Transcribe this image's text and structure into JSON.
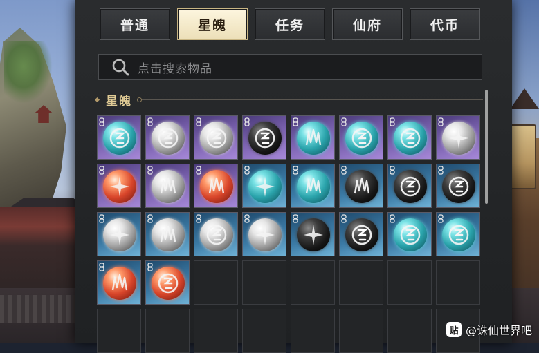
{
  "tabs": [
    {
      "label": "普通",
      "active": false
    },
    {
      "label": "星魄",
      "active": true
    },
    {
      "label": "任务",
      "active": false
    },
    {
      "label": "仙府",
      "active": false
    },
    {
      "label": "代币",
      "active": false
    }
  ],
  "search": {
    "placeholder": "点击搜索物品",
    "icon": "search-icon"
  },
  "section": {
    "title": "星魄"
  },
  "items": [
    {
      "bg": "purple",
      "orb": "cyan",
      "symbol": "spiral"
    },
    {
      "bg": "purple",
      "orb": "white",
      "symbol": "spiral"
    },
    {
      "bg": "purple",
      "orb": "white",
      "symbol": "spiral"
    },
    {
      "bg": "purple",
      "orb": "black",
      "symbol": "spiral"
    },
    {
      "bg": "purple",
      "orb": "cyan",
      "symbol": "spikes"
    },
    {
      "bg": "purple",
      "orb": "cyan",
      "symbol": "spiral"
    },
    {
      "bg": "purple",
      "orb": "cyan",
      "symbol": "spiral"
    },
    {
      "bg": "purple",
      "orb": "white",
      "symbol": "star"
    },
    {
      "bg": "purple",
      "orb": "red",
      "symbol": "star"
    },
    {
      "bg": "purple",
      "orb": "white",
      "symbol": "spikes"
    },
    {
      "bg": "purple",
      "orb": "red",
      "symbol": "spikes"
    },
    {
      "bg": "blue",
      "orb": "cyan",
      "symbol": "star"
    },
    {
      "bg": "blue",
      "orb": "cyan",
      "symbol": "spikes"
    },
    {
      "bg": "blue",
      "orb": "black",
      "symbol": "spikes"
    },
    {
      "bg": "blue",
      "orb": "black",
      "symbol": "spiral"
    },
    {
      "bg": "blue",
      "orb": "black",
      "symbol": "spiral"
    },
    {
      "bg": "blue",
      "orb": "white",
      "symbol": "star"
    },
    {
      "bg": "blue",
      "orb": "white",
      "symbol": "spikes"
    },
    {
      "bg": "blue",
      "orb": "white",
      "symbol": "spiral"
    },
    {
      "bg": "blue",
      "orb": "white",
      "symbol": "star"
    },
    {
      "bg": "blue",
      "orb": "black",
      "symbol": "star"
    },
    {
      "bg": "blue",
      "orb": "black",
      "symbol": "spiral"
    },
    {
      "bg": "blue",
      "orb": "cyan",
      "symbol": "spiral"
    },
    {
      "bg": "blue",
      "orb": "cyan",
      "symbol": "spiral"
    },
    {
      "bg": "blue",
      "orb": "red",
      "symbol": "spikes"
    },
    {
      "bg": "blue",
      "orb": "red",
      "symbol": "spiral"
    }
  ],
  "empty_slots": 14,
  "colors": {
    "active_tab": "#f5ecd2",
    "section_title": "#e0cb95",
    "panel": "#262829"
  },
  "watermark": {
    "logo": "贴",
    "text": "@诛仙世界吧"
  }
}
